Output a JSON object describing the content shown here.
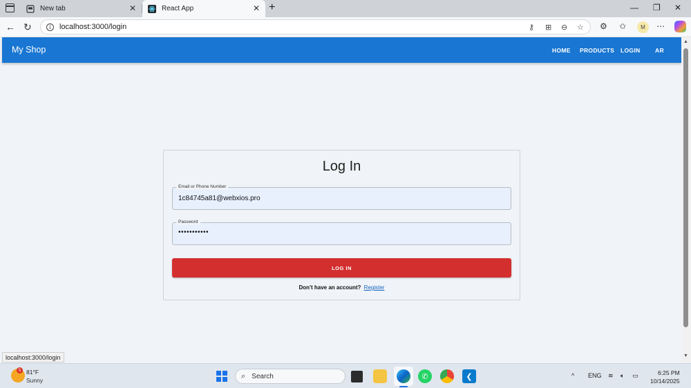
{
  "browser": {
    "tabs": [
      {
        "title": "New tab",
        "active": false
      },
      {
        "title": "React App",
        "active": true
      }
    ],
    "url": "localhost:3000/login",
    "profile_initial": "M",
    "status_url": "localhost:3000/login"
  },
  "app": {
    "brand": "My Shop",
    "nav": [
      "HOME",
      "PRODUCTS",
      "LOGIN",
      "AR"
    ],
    "accent_color": "#1976d2"
  },
  "login_form": {
    "title": "Log In",
    "email_label": "Email or Phone Number",
    "email_value": "1c84745a81@webxios.pro",
    "password_label": "Password",
    "password_value": "•••••••••••",
    "submit_label": "LOG IN",
    "submit_color": "#d32f2f",
    "register_prompt": "Don't have an account?",
    "register_link": "Register"
  },
  "taskbar": {
    "weather_badge": "5",
    "temperature": "81°F",
    "condition": "Sunny",
    "search_placeholder": "Search",
    "language": "ENG",
    "time": "6:25 PM",
    "date": "10/14/2025"
  }
}
